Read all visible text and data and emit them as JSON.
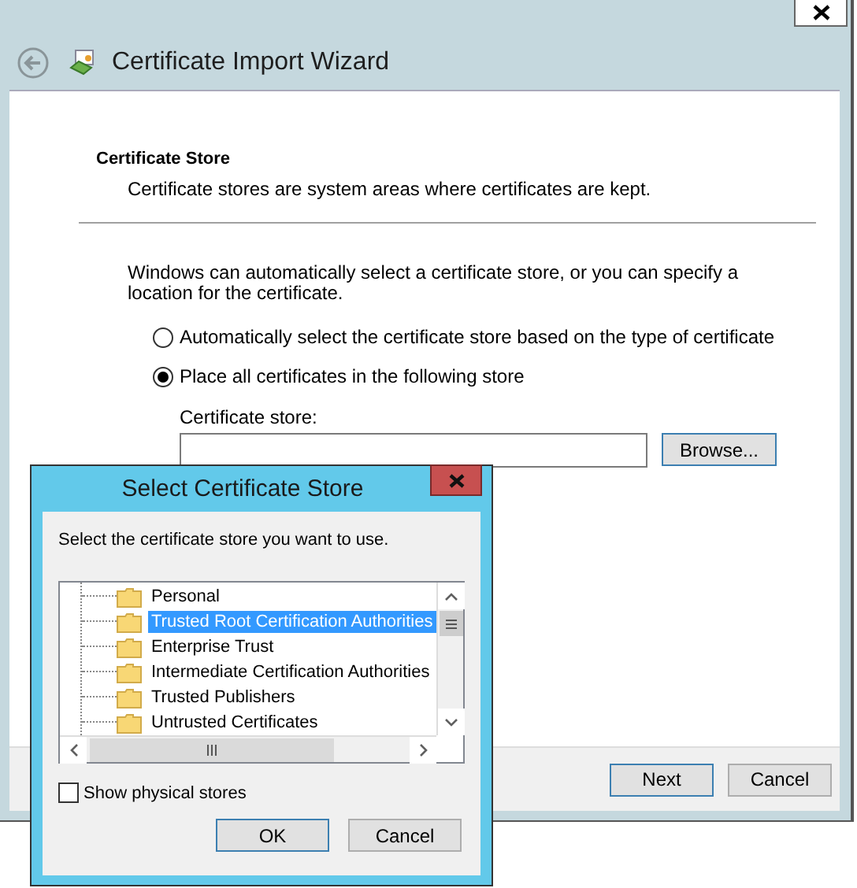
{
  "wizard": {
    "title": "Certificate Import Wizard",
    "heading": "Certificate Store",
    "subheading": "Certificate stores are system areas where certificates are kept.",
    "description": "Windows can automatically select a certificate store, or you can specify a location for the certificate.",
    "options": [
      {
        "label": "Automatically select the certificate store based on the type of certificate",
        "selected": false
      },
      {
        "label": "Place all certificates in the following store",
        "selected": true
      }
    ],
    "store_label": "Certificate store:",
    "browse_button": "Browse...",
    "buttons": [
      "Next",
      "Cancel"
    ]
  },
  "dialog": {
    "title": "Select Certificate Store",
    "prompt": "Select the certificate store you want to use.",
    "stores": [
      {
        "label": "Personal",
        "selected": false
      },
      {
        "label": "Trusted Root Certification Authorities",
        "selected": true
      },
      {
        "label": "Enterprise Trust",
        "selected": false
      },
      {
        "label": "Intermediate Certification Authorities",
        "selected": false
      },
      {
        "label": "Trusted Publishers",
        "selected": false
      },
      {
        "label": "Untrusted Certificates",
        "selected": false
      }
    ],
    "show_physical": {
      "label": "Show physical stores",
      "checked": false
    },
    "buttons": [
      "OK",
      "Cancel"
    ]
  }
}
